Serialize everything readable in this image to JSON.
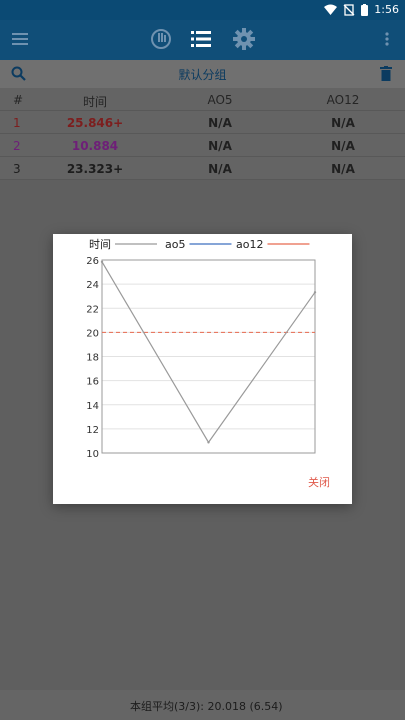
{
  "status": {
    "time": "1:56"
  },
  "toolbar": {
    "group_title": "默认分组"
  },
  "table": {
    "headers": [
      "#",
      "时间",
      "AO5",
      "AO12"
    ],
    "rows": [
      {
        "index": "1",
        "time": "25.846+",
        "ao5": "N/A",
        "ao12": "N/A",
        "color": "#7d1e1e"
      },
      {
        "index": "2",
        "time": "10.884",
        "ao5": "N/A",
        "ao12": "N/A",
        "color": "#6e1f78"
      },
      {
        "index": "3",
        "time": "23.323+",
        "ao5": "N/A",
        "ao12": "N/A",
        "color": "#1d1d1d"
      }
    ]
  },
  "dialog": {
    "close_label": "关闭",
    "chart_data": {
      "type": "line",
      "x": [
        1,
        2,
        3
      ],
      "series": [
        {
          "name": "时间",
          "values": [
            25.846,
            10.884,
            23.323
          ],
          "color": "#9a9a9a"
        },
        {
          "name": "ao5",
          "values": [],
          "color": "#3f6fbf"
        },
        {
          "name": "ao12",
          "values": [],
          "color": "#e8694f"
        }
      ],
      "reference_line": {
        "value": 20,
        "color": "#e8694f",
        "style": "dashed"
      },
      "ylim": [
        10,
        26
      ],
      "yticks": [
        10,
        12,
        14,
        16,
        18,
        20,
        22,
        24,
        26
      ],
      "grid": true,
      "legend": "top"
    }
  },
  "bottom": {
    "summary": "本组平均(3/3): 20.018 (6.54)"
  }
}
